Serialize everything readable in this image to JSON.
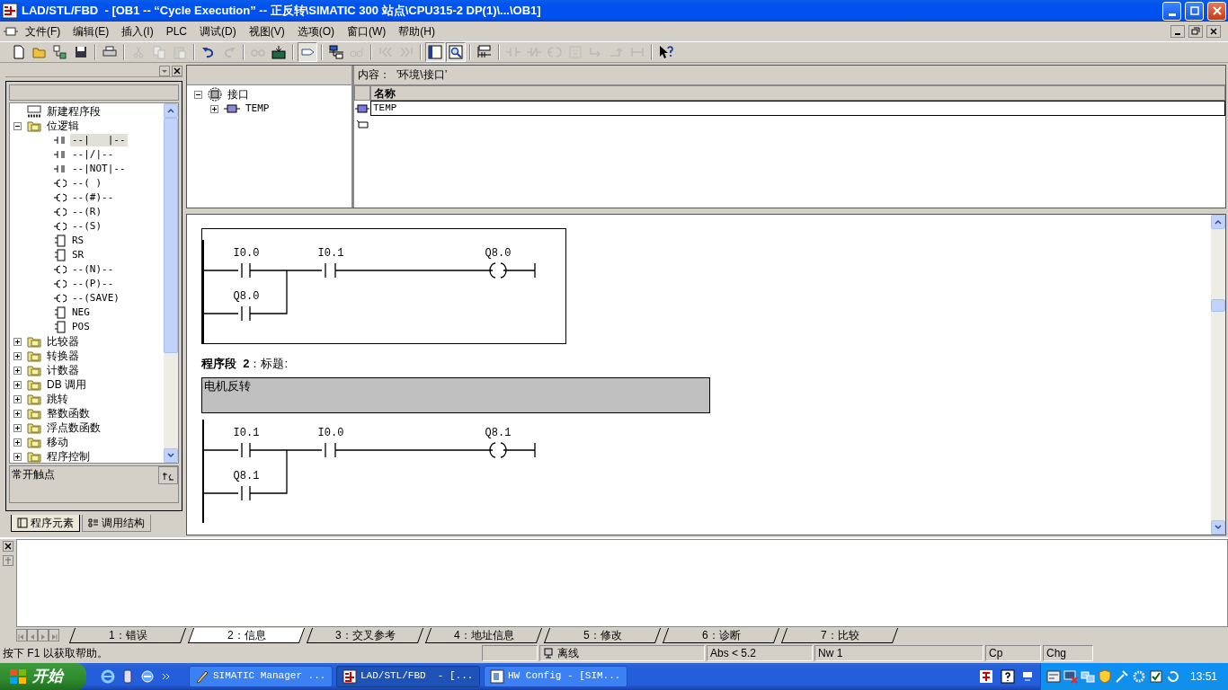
{
  "window": {
    "title": "LAD/STL/FBD  - [OB1 -- “Cycle Execution” -- 正反转\\SIMATIC 300 站点\\CPU315-2 DP(1)\\...\\OB1]"
  },
  "menu": [
    "文件(F)",
    "编辑(E)",
    "插入(I)",
    "PLC",
    "调试(D)",
    "视图(V)",
    "选项(O)",
    "窗口(W)",
    "帮助(H)"
  ],
  "toolbar": [
    {
      "kind": "new",
      "disabled": false
    },
    {
      "kind": "open",
      "disabled": false
    },
    {
      "kind": "station",
      "disabled": false
    },
    {
      "kind": "save",
      "disabled": false
    },
    {
      "kind": "separator"
    },
    {
      "kind": "print",
      "disabled": false
    },
    {
      "kind": "separator"
    },
    {
      "kind": "cut",
      "disabled": true
    },
    {
      "kind": "copy",
      "disabled": true
    },
    {
      "kind": "paste",
      "disabled": true
    },
    {
      "kind": "separator"
    },
    {
      "kind": "undo",
      "disabled": false
    },
    {
      "kind": "redo",
      "disabled": true
    },
    {
      "kind": "separator"
    },
    {
      "kind": "monitor",
      "disabled": true
    },
    {
      "kind": "download",
      "disabled": false
    },
    {
      "kind": "separator"
    },
    {
      "kind": "tag",
      "disabled": false,
      "pressed": true
    },
    {
      "kind": "separator"
    },
    {
      "kind": "network",
      "disabled": false
    },
    {
      "kind": "glasses",
      "disabled": true
    },
    {
      "kind": "separator"
    },
    {
      "kind": "prev",
      "disabled": true
    },
    {
      "kind": "next",
      "disabled": true
    },
    {
      "kind": "separator"
    },
    {
      "kind": "overview",
      "disabled": false,
      "pressed": true
    },
    {
      "kind": "zoom",
      "disabled": false,
      "pressed": true
    },
    {
      "kind": "separator"
    },
    {
      "kind": "rung",
      "disabled": false
    },
    {
      "kind": "separator"
    },
    {
      "kind": "contact",
      "disabled": true
    },
    {
      "kind": "ncontact",
      "disabled": true
    },
    {
      "kind": "coil",
      "disabled": true
    },
    {
      "kind": "box",
      "disabled": true
    },
    {
      "kind": "branchopen",
      "disabled": true
    },
    {
      "kind": "branchclose",
      "disabled": true
    },
    {
      "kind": "connector",
      "disabled": true
    },
    {
      "kind": "separator"
    },
    {
      "kind": "help",
      "disabled": false
    }
  ],
  "sidebar": {
    "tree": [
      {
        "label": "新建程序段",
        "kind": "network",
        "selected": false
      },
      {
        "label": "位逻辑",
        "kind": "folder",
        "expanded": true,
        "selected": false,
        "children": [
          {
            "label": "--|   |--",
            "kind": "contact",
            "selected": true
          },
          {
            "label": "--|/|--",
            "kind": "contact",
            "selected": false
          },
          {
            "label": "--|NOT|--",
            "kind": "contact",
            "selected": false
          },
          {
            "label": "--( )",
            "kind": "coil",
            "selected": false
          },
          {
            "label": "--(#)--",
            "kind": "coil",
            "selected": false
          },
          {
            "label": "--(R)",
            "kind": "coil",
            "selected": false
          },
          {
            "label": "--(S)",
            "kind": "coil",
            "selected": false
          },
          {
            "label": "RS",
            "kind": "box",
            "selected": false
          },
          {
            "label": "SR",
            "kind": "box",
            "selected": false
          },
          {
            "label": "--(N)--",
            "kind": "coil",
            "selected": false
          },
          {
            "label": "--(P)--",
            "kind": "coil",
            "selected": false
          },
          {
            "label": "--(SAVE)",
            "kind": "coil",
            "selected": false
          },
          {
            "label": "NEG",
            "kind": "box",
            "selected": false
          },
          {
            "label": "POS",
            "kind": "box",
            "selected": false
          }
        ]
      },
      {
        "label": "比较器",
        "kind": "folder",
        "expanded": false,
        "selected": false
      },
      {
        "label": "转换器",
        "kind": "folder",
        "expanded": false,
        "selected": false
      },
      {
        "label": "计数器",
        "kind": "folder",
        "expanded": false,
        "selected": false
      },
      {
        "label": "DB 调用",
        "kind": "folder",
        "expanded": false,
        "selected": false
      },
      {
        "label": "跳转",
        "kind": "folder",
        "expanded": false,
        "selected": false
      },
      {
        "label": "整数函数",
        "kind": "folder",
        "expanded": false,
        "selected": false
      },
      {
        "label": "浮点数函数",
        "kind": "folder",
        "expanded": false,
        "selected": false
      },
      {
        "label": "移动",
        "kind": "folder",
        "expanded": false,
        "selected": false
      },
      {
        "label": "程序控制",
        "kind": "folder",
        "expanded": false,
        "selected": false
      }
    ],
    "description": "常开触点",
    "tabs": [
      {
        "label": "程序元素",
        "selected": true
      },
      {
        "label": "调用结构",
        "selected": false
      }
    ]
  },
  "interface": {
    "tree": [
      {
        "label": "接口",
        "expanded": true,
        "children": [
          {
            "label": "TEMP",
            "expanded": false
          }
        ]
      }
    ],
    "content_title": "内容：  ’环境\\接口’",
    "column": "名称",
    "rows": [
      "TEMP"
    ]
  },
  "networks": [
    {
      "selected": true,
      "rung": {
        "contact_1": "I0.0",
        "contact_2": "I0.1",
        "branch": "Q8.0",
        "coil": "Q8.0"
      }
    },
    {
      "selected": false,
      "title": "**程序段  2**：标题:",
      "comment": "电机反转",
      "rung": {
        "contact_1": "I0.1",
        "contact_2": "I0.0",
        "branch": "Q8.1",
        "coil": "Q8.1"
      }
    }
  ],
  "output_tabs": [
    {
      "label": "1：错误",
      "selected": false
    },
    {
      "label": "2：信息",
      "selected": true
    },
    {
      "label": "3：交叉参考",
      "selected": false
    },
    {
      "label": "4：地址信息",
      "selected": false
    },
    {
      "label": "5：修改",
      "selected": false
    },
    {
      "label": "6：诊断",
      "selected": false
    },
    {
      "label": "7：比较",
      "selected": false
    }
  ],
  "status_bar": [
    "按下 F1 以获取帮助。",
    "离线",
    "Abs < 5.2",
    "Nw 1",
    "Cp",
    "Chg"
  ],
  "taskbar": {
    "start": "开始",
    "tasks": [
      {
        "label": "SIMATIC Manager ...",
        "selected": false
      },
      {
        "label": "LAD/STL/FBD  - [...",
        "selected": true
      },
      {
        "label": "HW Config - [SIM...",
        "selected": false
      }
    ],
    "clock": "13:51"
  }
}
